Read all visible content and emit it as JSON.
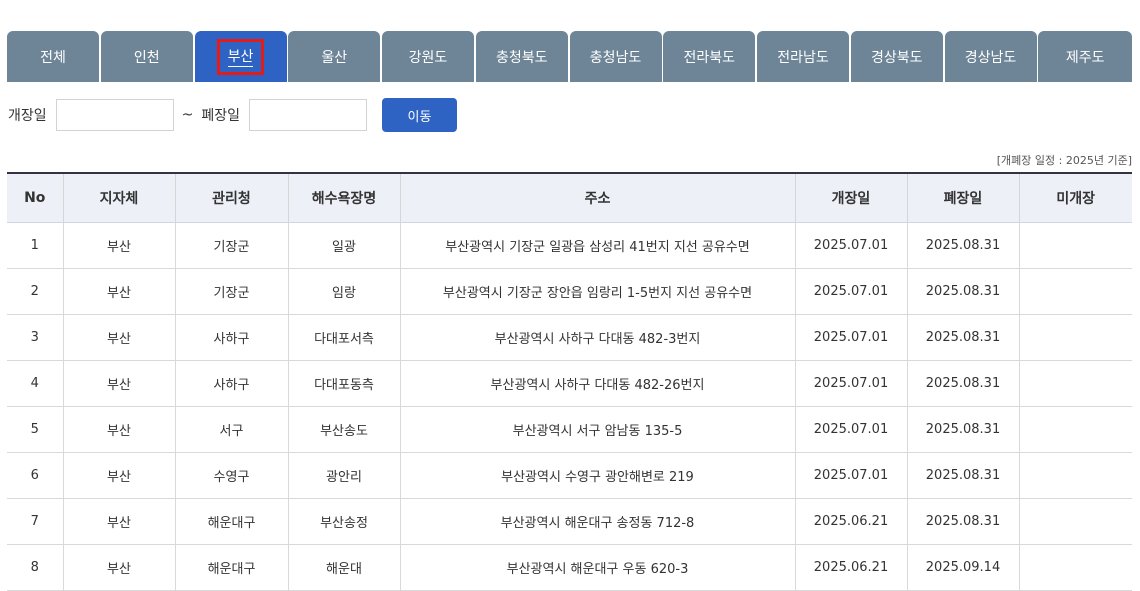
{
  "tabs": [
    {
      "label": "전체"
    },
    {
      "label": "인천"
    },
    {
      "label": "부산",
      "active": true
    },
    {
      "label": "울산"
    },
    {
      "label": "강원도"
    },
    {
      "label": "충청북도"
    },
    {
      "label": "충청남도"
    },
    {
      "label": "전라북도"
    },
    {
      "label": "전라남도"
    },
    {
      "label": "경상북도"
    },
    {
      "label": "경상남도"
    },
    {
      "label": "제주도"
    }
  ],
  "filter": {
    "open_label": "개장일",
    "open_value": "",
    "tilde": "~",
    "close_label": "폐장일",
    "close_value": "",
    "move_button": "이동"
  },
  "notice": "[개폐장 일정 : 2025년 기준]",
  "table": {
    "headers": [
      "No",
      "지자체",
      "관리청",
      "해수욕장명",
      "주소",
      "개장일",
      "폐장일",
      "미개장"
    ],
    "rows": [
      [
        "1",
        "부산",
        "기장군",
        "일광",
        "부산광역시 기장군 일광읍 삼성리 41번지 지선 공유수면",
        "2025.07.01",
        "2025.08.31",
        ""
      ],
      [
        "2",
        "부산",
        "기장군",
        "임랑",
        "부산광역시 기장군 장안읍 임랑리 1-5번지 지선 공유수면",
        "2025.07.01",
        "2025.08.31",
        ""
      ],
      [
        "3",
        "부산",
        "사하구",
        "다대포서측",
        "부산광역시 사하구 다대동 482-3번지",
        "2025.07.01",
        "2025.08.31",
        ""
      ],
      [
        "4",
        "부산",
        "사하구",
        "다대포동측",
        "부산광역시 사하구 다대동 482-26번지",
        "2025.07.01",
        "2025.08.31",
        ""
      ],
      [
        "5",
        "부산",
        "서구",
        "부산송도",
        "부산광역시 서구 암남동 135-5",
        "2025.07.01",
        "2025.08.31",
        ""
      ],
      [
        "6",
        "부산",
        "수영구",
        "광안리",
        "부산광역시 수영구 광안해변로 219",
        "2025.07.01",
        "2025.08.31",
        ""
      ],
      [
        "7",
        "부산",
        "해운대구",
        "부산송정",
        "부산광역시 해운대구 송정동 712-8",
        "2025.06.21",
        "2025.08.31",
        ""
      ],
      [
        "8",
        "부산",
        "해운대구",
        "해운대",
        "부산광역시 해운대구 우동 620-3",
        "2025.06.21",
        "2025.09.14",
        ""
      ]
    ]
  }
}
